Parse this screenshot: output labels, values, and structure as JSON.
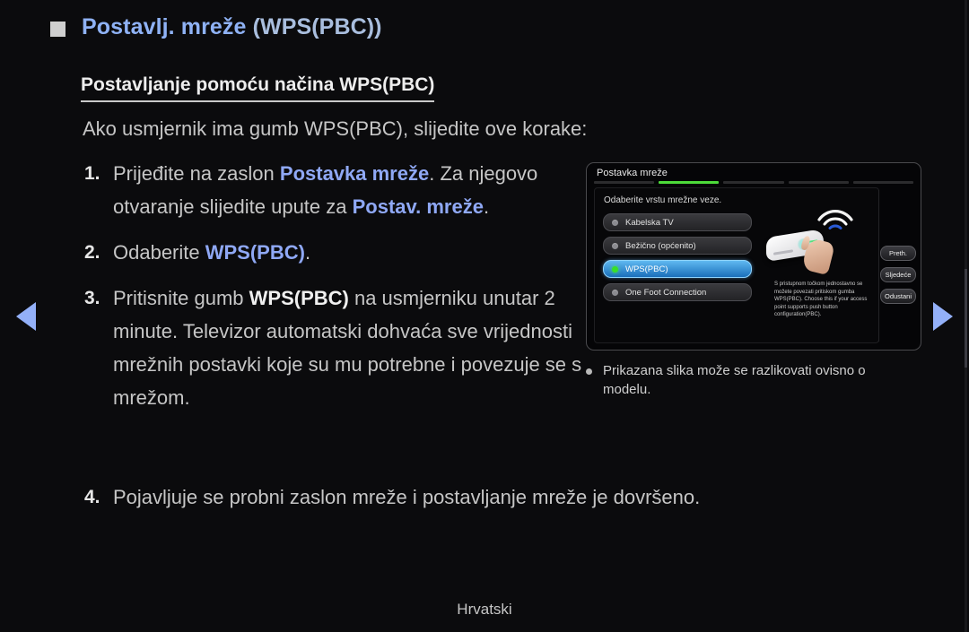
{
  "header": {
    "title_main": "Postavlj. mreže ",
    "title_paren": "(WPS(PBC))",
    "bullet_icon": "square-bullet-icon"
  },
  "subtitle": "Postavljanje pomoću načina WPS(PBC)",
  "intro": "Ako usmjernik ima gumb WPS(PBC), slijedite ove korake:",
  "steps": [
    {
      "num": "1.",
      "parts": [
        {
          "text": "Prijeđite na zaslon ",
          "style": "normal"
        },
        {
          "text": "Postavka mreže",
          "style": "blue"
        },
        {
          "text": ". Za njegovo otvaranje slijedite upute za ",
          "style": "normal"
        },
        {
          "text": "Postav. mreže",
          "style": "blue"
        },
        {
          "text": ".",
          "style": "normal"
        }
      ]
    },
    {
      "num": "2.",
      "parts": [
        {
          "text": "Odaberite ",
          "style": "normal"
        },
        {
          "text": "WPS(PBC)",
          "style": "blue"
        },
        {
          "text": ".",
          "style": "normal"
        }
      ]
    },
    {
      "num": "3.",
      "parts": [
        {
          "text": "Pritisnite gumb ",
          "style": "normal"
        },
        {
          "text": "WPS(PBC)",
          "style": "white"
        },
        {
          "text": " na usmjerniku unutar 2 minute. Televizor automatski dohvaća sve vrijednosti mrežnih postavki koje su mu potrebne i povezuje se s mrežom.",
          "style": "normal"
        }
      ]
    }
  ],
  "step4": {
    "num": "4.",
    "text": "Pojavljuje se probni zaslon mreže i postavljanje mreže je dovršeno."
  },
  "tv_panel": {
    "title": "Postavka mreže",
    "tab_segments": 5,
    "active_segment": 2,
    "prompt": "Odaberite vrstu mrežne veze.",
    "menu_items": [
      {
        "label": "Kabelska TV",
        "selected": false
      },
      {
        "label": "Bežično (općenito)",
        "selected": false
      },
      {
        "label": "WPS(PBC)",
        "selected": true
      },
      {
        "label": "One Foot Connection",
        "selected": false
      }
    ],
    "description": "S pristupnom točkom jednostavno se možete povezati pritiskom gumba WPS(PBC). Choose this if your access point supports push button configuration(PBC).",
    "buttons": [
      "Preth.",
      "Sljedeće",
      "Odustani"
    ],
    "illustration": "router-with-hand-press-icon",
    "accent_green": "#4ddb3a",
    "accent_blue": "#5fb8f0"
  },
  "caption": "Prikazana slika može se razlikovati ovisno o modelu.",
  "nav": {
    "prev_icon": "triangle-left-icon",
    "next_icon": "triangle-right-icon",
    "arrow_color": "#93b0f8"
  },
  "footer": "Hrvatski"
}
